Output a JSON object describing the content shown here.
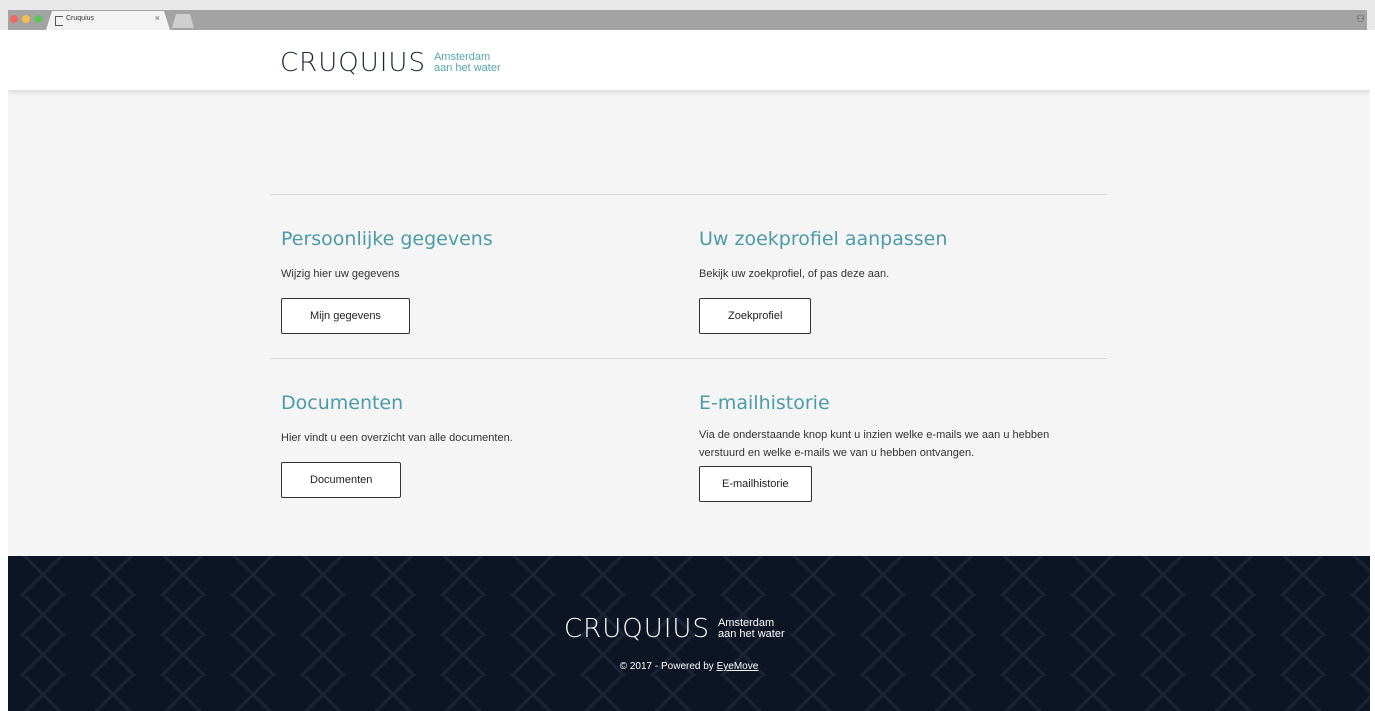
{
  "browser": {
    "tab_title": "Cruquius",
    "close_glyph": "×",
    "profile_glyph": "⚇",
    "tab_icon": "page-icon"
  },
  "site": {
    "logo_word": "CRUQUIUS",
    "logo_tagline_1": "Amsterdam",
    "logo_tagline_2": "aan het water"
  },
  "cards": [
    {
      "title": "Persoonlijke gegevens",
      "description": "Wijzig hier uw gegevens",
      "button": "Mijn gegevens"
    },
    {
      "title": "Uw zoekprofiel aanpassen",
      "description": "Bekijk uw zoekprofiel, of pas deze aan.",
      "button": "Zoekprofiel"
    },
    {
      "title": "Documenten",
      "description": "Hier vindt u een overzicht van alle documenten.",
      "button": "Documenten"
    },
    {
      "title": "E-mailhistorie",
      "description": "Via de onderstaande knop kunt u inzien welke e-mails we aan u hebben verstuurd en welke e-mails we van u hebben ontvangen.",
      "button": "E-mailhistorie"
    }
  ],
  "footer": {
    "copyright_prefix": "© 2017 - Powered by",
    "powered_by_link": "EyeMove"
  },
  "colors": {
    "accent": "#4c9ba8",
    "footer_bg": "#0d1424",
    "page_bg": "#f5f5f5"
  }
}
